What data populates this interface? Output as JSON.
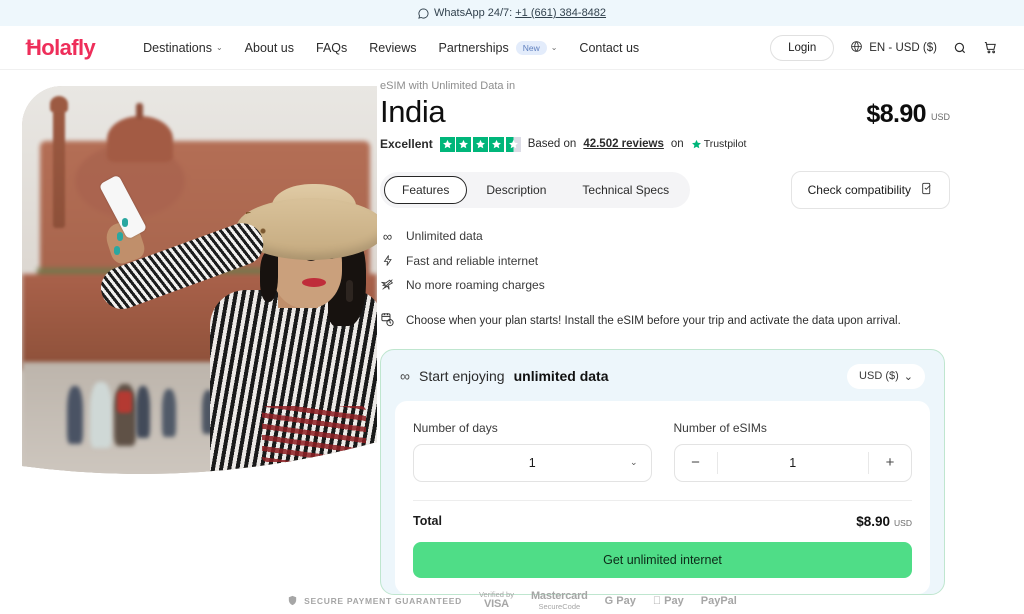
{
  "topbar": {
    "icon": "whatsapp-icon",
    "text": "WhatsApp 24/7:",
    "phone": "+1 (661) 384-8482"
  },
  "header": {
    "logo": "Holafly",
    "nav": [
      {
        "label": "Destinations",
        "caret": "⌄",
        "badge": ""
      },
      {
        "label": "About us",
        "caret": "",
        "badge": ""
      },
      {
        "label": "FAQs",
        "caret": "",
        "badge": ""
      },
      {
        "label": "Reviews",
        "caret": "",
        "badge": ""
      },
      {
        "label": "Partnerships",
        "caret": "⌄",
        "badge": "New"
      },
      {
        "label": "Contact us",
        "caret": "",
        "badge": ""
      }
    ],
    "login_label": "Login",
    "language": "EN - USD ($)",
    "search_icon": "search-icon",
    "cart_icon": "cart-icon"
  },
  "product": {
    "eyebrow": "eSIM with Unlimited Data in",
    "country": "India",
    "price": "$8.90",
    "price_currency": "USD"
  },
  "rating": {
    "label": "Excellent",
    "stars_full": 4,
    "stars_half": 1,
    "based_on": "Based on",
    "reviews": "42.502 reviews",
    "on": "on",
    "platform": "Trustpilot"
  },
  "tabs": [
    {
      "label": "Features",
      "active": true
    },
    {
      "label": "Description",
      "active": false
    },
    {
      "label": "Technical Specs",
      "active": false
    }
  ],
  "compatibility": {
    "label": "Check compatibility",
    "icon": "device-check-icon"
  },
  "features": [
    {
      "icon": "infinity-icon",
      "glyph": "∞",
      "label": "Unlimited data"
    },
    {
      "icon": "lightning-icon",
      "glyph": "⚡",
      "label": "Fast and reliable internet"
    },
    {
      "icon": "no-roaming-icon",
      "glyph": "✈",
      "label": "No more roaming charges"
    }
  ],
  "notice": {
    "icon": "calendar-clock-icon",
    "text": "Choose when your plan starts! Install the eSIM before your trip and activate the data upon arrival."
  },
  "purchase_card": {
    "header_icon": "infinity-icon",
    "header_prefix": "Start enjoying",
    "header_strong": "unlimited data",
    "currency_selector": "USD ($)",
    "days_label": "Number of days",
    "days_value": "1",
    "esims_label": "Number of eSIMs",
    "esims_value": "1",
    "minus_label": "−",
    "plus_label": "+",
    "total_label": "Total",
    "total_amount": "$8.90",
    "total_currency": "USD",
    "cta_label": "Get unlimited internet"
  },
  "payments": {
    "secure_text": "SECURE PAYMENT GUARANTEED",
    "shield_icon": "shield-check-icon",
    "methods": [
      {
        "top": "Verified by",
        "main": "VISA"
      },
      {
        "top": "Mastercard",
        "main": "SecureCode"
      },
      {
        "top": "",
        "main": "G Pay"
      },
      {
        "top": "",
        "main": " Pay"
      },
      {
        "top": "",
        "main": "PayPal"
      }
    ]
  },
  "colors": {
    "brand": "#ee2e5a",
    "cta": "#4fdd87",
    "trustpilot": "#00b67a",
    "card_border": "#bfe6cf",
    "card_bg": "#edf6fb"
  }
}
